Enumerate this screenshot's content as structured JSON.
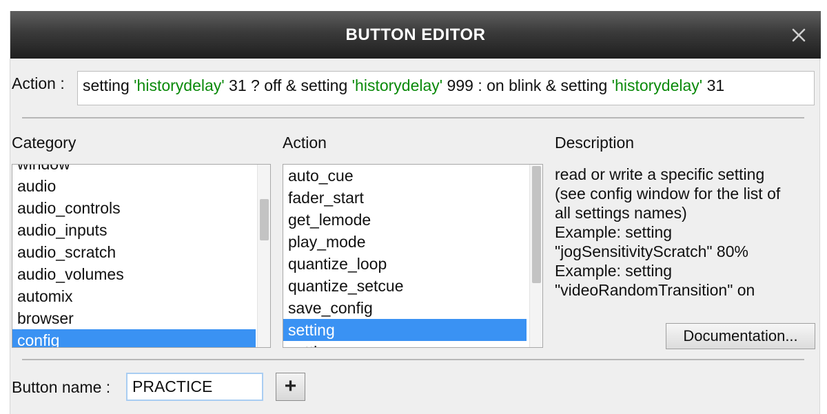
{
  "window": {
    "title": "BUTTON EDITOR",
    "close_icon": "close-icon"
  },
  "action": {
    "label": "Action :",
    "script_parts": [
      {
        "text": "setting ",
        "color": "#111111"
      },
      {
        "text": "'historydelay'",
        "color": "#0a8a0a"
      },
      {
        "text": " 31 ? off & setting ",
        "color": "#111111"
      },
      {
        "text": "'historydelay'",
        "color": "#0a8a0a"
      },
      {
        "text": " 999 : on blink & setting ",
        "color": "#111111"
      },
      {
        "text": "'historydelay'",
        "color": "#0a8a0a"
      },
      {
        "text": " 31",
        "color": "#111111"
      }
    ]
  },
  "category": {
    "header": "Category",
    "partial_top": "window",
    "items": [
      "audio",
      "audio_controls",
      "audio_inputs",
      "audio_scratch",
      "audio_volumes",
      "automix",
      "browser",
      "config"
    ],
    "selected": "config"
  },
  "action_list": {
    "header": "Action",
    "items": [
      "auto_cue",
      "fader_start",
      "get_lemode",
      "play_mode",
      "quantize_loop",
      "quantize_setcue",
      "save_config",
      "setting"
    ],
    "partial_bottom": "setting",
    "selected": "setting"
  },
  "description": {
    "header": "Description",
    "lines": [
      "read or write a specific setting",
      "(see config window for the list of",
      "all settings names)",
      "Example: setting",
      "\"jogSensitivityScratch\" 80%",
      "Example: setting",
      "\"videoRandomTransition\" on"
    ],
    "doc_button": "Documentation..."
  },
  "button_name": {
    "label": "Button name :",
    "value": "PRACTICE",
    "add_label": "+"
  },
  "colors": {
    "selection": "#3a92f3",
    "string_literal": "#0a8a0a"
  }
}
